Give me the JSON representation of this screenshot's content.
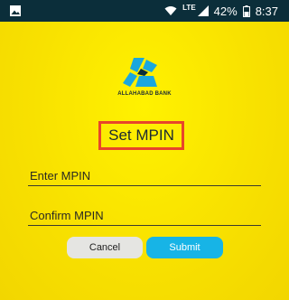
{
  "status_bar": {
    "network_label": "LTE",
    "battery_percent": "42%",
    "time": "8:37",
    "icons": [
      "image-icon",
      "wifi-icon",
      "signal-icon",
      "battery-icon"
    ]
  },
  "brand": {
    "bank_name": "ALLAHABAD BANK",
    "logo_icon": "allahabad-bank-logo-icon",
    "colors": {
      "background": "#F7E400",
      "status_bar": "#0B2E3A",
      "logo_blue": "#1AA7DE",
      "title_border": "#E8452A",
      "submit_button": "#17B4E6",
      "cancel_button": "#E5E5E2"
    }
  },
  "form": {
    "title": "Set MPIN",
    "mpin_placeholder": "Enter MPIN",
    "confirm_placeholder": "Confirm MPIN",
    "cancel_label": "Cancel",
    "submit_label": "Submit"
  }
}
